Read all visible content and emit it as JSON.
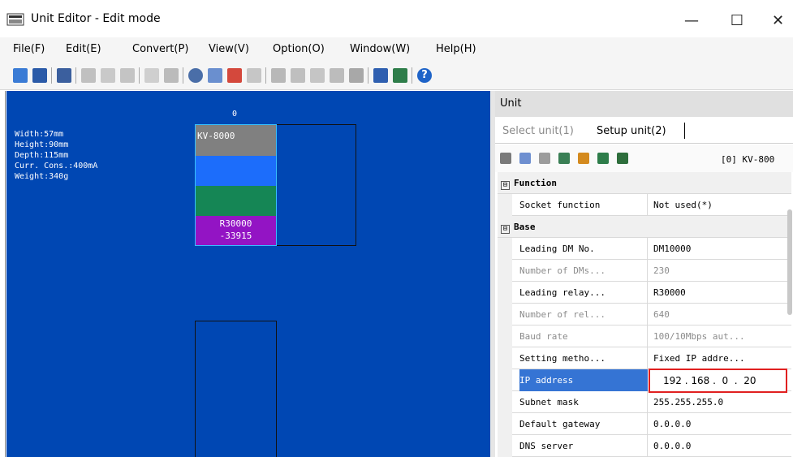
{
  "window": {
    "title": "Unit Editor - Edit mode",
    "minimize_glyph": "—",
    "maximize_glyph": "☐",
    "close_glyph": "✕"
  },
  "menu": [
    "File(F)",
    "Edit(E)",
    "Convert(P)",
    "View(V)",
    "Option(O)",
    "Window(W)",
    "Help(H)"
  ],
  "toolbar_icons": [
    "read-unit-icon",
    "write-unit-icon",
    "unit-settings-icon",
    "cut-icon",
    "copy-icon",
    "paste-icon",
    "edit-icon",
    "grid-icon",
    "rs-icon",
    "rl-icon",
    "check-icon",
    "link-icon",
    "unit-a-icon",
    "unit-b-icon",
    "unit-c-icon",
    "unit-d-icon",
    "kl-icon",
    "wrench-icon",
    "monitor-icon",
    "help-icon"
  ],
  "canvas": {
    "specs": [
      "Width:57mm",
      "Height:90mm",
      "Depth:115mm",
      "Curr. Cons.:400mA",
      "Weight:340g"
    ],
    "slot_label": "0",
    "module_name": "KV-8000",
    "relay_range_1": "R30000",
    "relay_range_2": "-33915",
    "band_colors": [
      "#808080",
      "#1c6dfb",
      "#158655",
      "#9314c4"
    ]
  },
  "panel": {
    "title": "Unit",
    "tab_select": "Select unit(1)",
    "tab_setup": "Setup unit(2)",
    "unit_id": "[0] KV-800",
    "tool_icons": [
      "sort-icon",
      "filter-icon",
      "mail-icon",
      "download-icon",
      "card-icon",
      "network-icon",
      "unit-icon"
    ]
  },
  "properties": [
    {
      "type": "section",
      "label": "Function"
    },
    {
      "type": "row",
      "name": "Socket function",
      "value": "Not used(*)"
    },
    {
      "type": "section",
      "label": "Base"
    },
    {
      "type": "row",
      "name": "Leading DM No.",
      "value": "DM10000"
    },
    {
      "type": "row",
      "name": "Number of DMs...",
      "value": "230",
      "dim": true
    },
    {
      "type": "row",
      "name": "Leading relay...",
      "value": "R30000"
    },
    {
      "type": "row",
      "name": "Number of rel...",
      "value": "640",
      "dim": true
    },
    {
      "type": "row",
      "name": "Baud rate",
      "value": "100/10Mbps aut...",
      "dim": true
    },
    {
      "type": "row",
      "name": "Setting metho...",
      "value": "Fixed IP addre..."
    },
    {
      "type": "row",
      "name": "IP address",
      "value": "",
      "selected": true
    },
    {
      "type": "row",
      "name": "Subnet mask",
      "value": "255.255.255.0"
    },
    {
      "type": "row",
      "name": "Default gateway",
      "value": "0.0.0.0"
    },
    {
      "type": "row",
      "name": "DNS server",
      "value": "0.0.0.0"
    }
  ],
  "ip_edit_value": "192 . 168 .  0  .  20",
  "section_toggle": "⊟"
}
